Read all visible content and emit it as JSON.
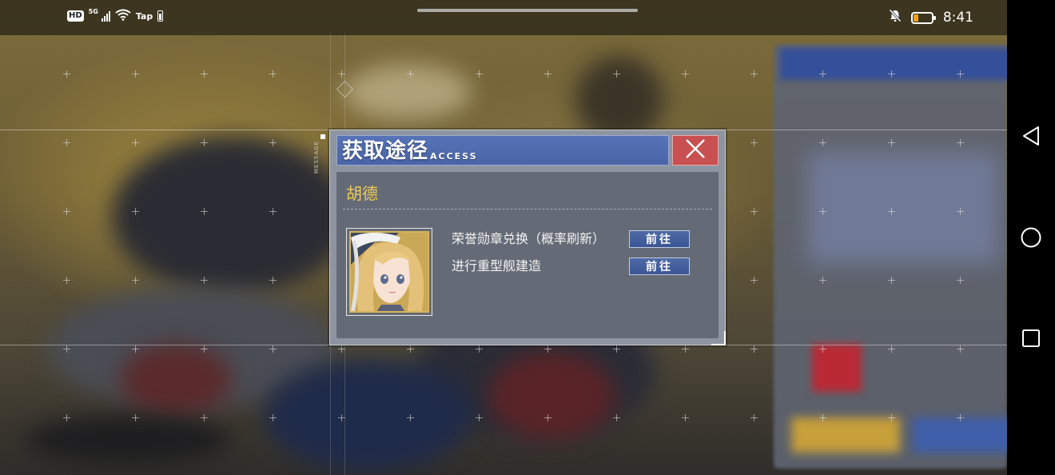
{
  "status_bar": {
    "hd_badge": "HD",
    "network": "5G",
    "app_tag": "Tap",
    "time": "8:41",
    "battery_level": 0.25,
    "battery_color": "#f2a218"
  },
  "background": {
    "message_label": "MESSAGE"
  },
  "dialog": {
    "title": "获取途径",
    "subtitle": "ACCESS",
    "close_icon": "close-icon",
    "character_name": "胡德",
    "character_name_color": "#efcc55",
    "acquisition_routes": [
      {
        "label": "荣誉勋章兑换（概率刷新）",
        "action_label": "前往"
      },
      {
        "label": "进行重型舰建造",
        "action_label": "前往"
      }
    ]
  },
  "nav_bar": {
    "buttons": [
      "back-icon",
      "home-icon",
      "recents-icon"
    ]
  }
}
